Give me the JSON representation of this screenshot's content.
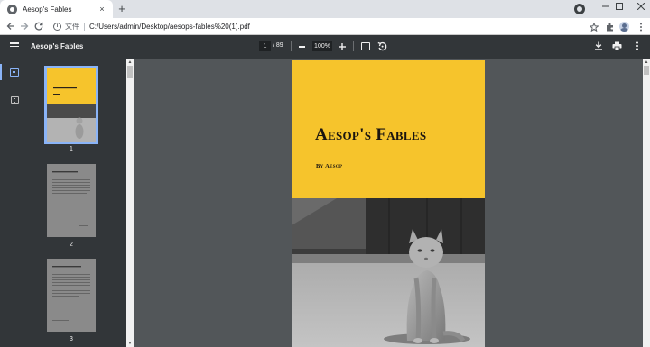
{
  "browser": {
    "tab_title": "Aesop's Fables",
    "close_glyph": "×",
    "new_tab_glyph": "+",
    "omnibox_label": "文件",
    "url": "C:/Users/admin/Desktop/aesops-fables%20(1).pdf",
    "icons": [
      "back-arrow-icon",
      "forward-arrow-icon",
      "reload-icon",
      "info-icon",
      "star-icon",
      "extensions-icon",
      "profile-avatar-icon",
      "kebab-menu-icon"
    ]
  },
  "pdf_toolbar": {
    "doc_title": "Aesop's Fables",
    "current_page": "1",
    "page_total": "/ 89",
    "zoom": "100%",
    "icons": [
      "menu-icon",
      "zoom-out-icon",
      "zoom-in-icon",
      "fit-page-icon",
      "rotate-icon",
      "download-icon",
      "print-icon",
      "more-icon"
    ]
  },
  "sidebar": {
    "thumbnails": [
      {
        "number": "1",
        "selected": true
      },
      {
        "number": "2",
        "selected": false
      },
      {
        "number": "3",
        "selected": false
      }
    ]
  },
  "page": {
    "title": "Aesop's Fables",
    "author": "By Aesop"
  },
  "colors": {
    "cover_yellow": "#f6c42c",
    "pdf_toolbar": "#323639",
    "viewer_bg": "#525659",
    "selection_blue": "#8ab4f8"
  }
}
